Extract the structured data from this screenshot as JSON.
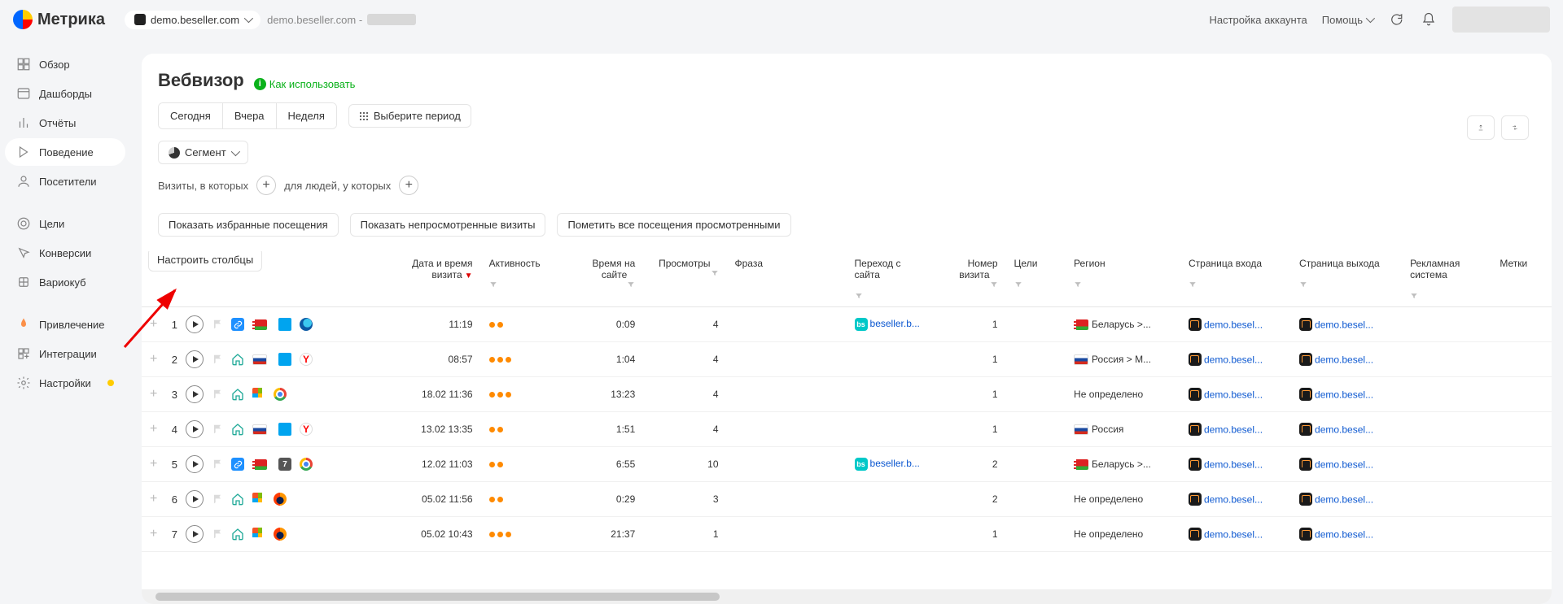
{
  "header": {
    "brand": "Метрика",
    "site_picker": "demo.beseller.com",
    "linked_site": "demo.beseller.com -",
    "account_settings": "Настройка аккаунта",
    "help_label": "Помощь"
  },
  "sidebar": {
    "items": [
      {
        "icon": "overview",
        "label": "Обзор"
      },
      {
        "icon": "dashboards",
        "label": "Дашборды"
      },
      {
        "icon": "reports",
        "label": "Отчёты"
      },
      {
        "icon": "behavior",
        "label": "Поведение",
        "active": true
      },
      {
        "icon": "visitors",
        "label": "Посетители"
      },
      {
        "icon": "goals",
        "label": "Цели"
      },
      {
        "icon": "conversions",
        "label": "Конверсии"
      },
      {
        "icon": "varioqub",
        "label": "Вариокуб"
      },
      {
        "icon": "acquisition",
        "label": "Привлечение"
      },
      {
        "icon": "integrations",
        "label": "Интеграции"
      },
      {
        "icon": "settings",
        "label": "Настройки",
        "badge": true
      }
    ]
  },
  "page": {
    "title": "Вебвизор",
    "howto": "Как использовать",
    "periods": {
      "today": "Сегодня",
      "yesterday": "Вчера",
      "week": "Неделя",
      "choose": "Выберите период"
    },
    "segment_label": "Сегмент",
    "filters": {
      "visits_where": "Визиты, в которых",
      "for_people": "для людей, у которых"
    },
    "actions": {
      "show_fav": "Показать избранные посещения",
      "show_unseen": "Показать непросмотренные визиты",
      "mark_seen": "Пометить все посещения просмотренными"
    },
    "configure_columns": "Настроить столбцы"
  },
  "table": {
    "columns": {
      "datetime": "Дата и время визита",
      "activity": "Активность",
      "time_on_site": "Время на сайте",
      "views": "Просмотры",
      "phrase": "Фраза",
      "referrer": "Переход с сайта",
      "visit_no": "Номер визита",
      "goals": "Цели",
      "region": "Регион",
      "entry": "Страница входа",
      "exit": "Страница выхода",
      "ad_system": "Рекламная система",
      "tags": "Метки"
    },
    "rows": [
      {
        "n": "1",
        "src": "link",
        "flag": "by",
        "os": "win-blue",
        "browser": "edge",
        "dt": "11:19",
        "act": 2,
        "time": "0:09",
        "views": "4",
        "ref": "beseller.b...",
        "visit": "1",
        "region_flag": "by",
        "region": "Беларусь >...",
        "entry": "demo.besel...",
        "exit": "demo.besel..."
      },
      {
        "n": "2",
        "src": "home",
        "flag": "ru",
        "os": "win-blue",
        "browser": "yandex",
        "dt": "08:57",
        "act": 3,
        "time": "1:04",
        "views": "4",
        "ref": "",
        "visit": "1",
        "region_flag": "ru",
        "region": "Россия > М...",
        "entry": "demo.besel...",
        "exit": "demo.besel..."
      },
      {
        "n": "3",
        "src": "home",
        "flag": "",
        "os": "win-tiles",
        "browser": "chrome",
        "dt": "18.02 11:36",
        "act": 3,
        "time": "13:23",
        "views": "4",
        "ref": "",
        "visit": "1",
        "region_flag": "",
        "region": "Не определено",
        "entry": "demo.besel...",
        "exit": "demo.besel..."
      },
      {
        "n": "4",
        "src": "home",
        "flag": "ru",
        "os": "win-blue",
        "browser": "yandex",
        "dt": "13.02 13:35",
        "act": 2,
        "time": "1:51",
        "views": "4",
        "ref": "",
        "visit": "1",
        "region_flag": "ru",
        "region": "Россия",
        "entry": "demo.besel...",
        "exit": "demo.besel..."
      },
      {
        "n": "5",
        "src": "link",
        "flag": "by",
        "os": "num7",
        "browser": "chrome",
        "dt": "12.02 11:03",
        "act": 2,
        "time": "6:55",
        "views": "10",
        "ref": "beseller.b...",
        "visit": "2",
        "region_flag": "by",
        "region": "Беларусь >...",
        "entry": "demo.besel...",
        "exit": "demo.besel..."
      },
      {
        "n": "6",
        "src": "home",
        "flag": "",
        "os": "win-tiles",
        "browser": "firefox",
        "dt": "05.02 11:56",
        "act": 2,
        "time": "0:29",
        "views": "3",
        "ref": "",
        "visit": "2",
        "region_flag": "",
        "region": "Не определено",
        "entry": "demo.besel...",
        "exit": "demo.besel..."
      },
      {
        "n": "7",
        "src": "home",
        "flag": "",
        "os": "win-tiles",
        "browser": "firefox",
        "dt": "05.02 10:43",
        "act": 3,
        "time": "21:37",
        "views": "1",
        "ref": "",
        "visit": "1",
        "region_flag": "",
        "region": "Не определено",
        "entry": "demo.besel...",
        "exit": "demo.besel..."
      }
    ]
  }
}
